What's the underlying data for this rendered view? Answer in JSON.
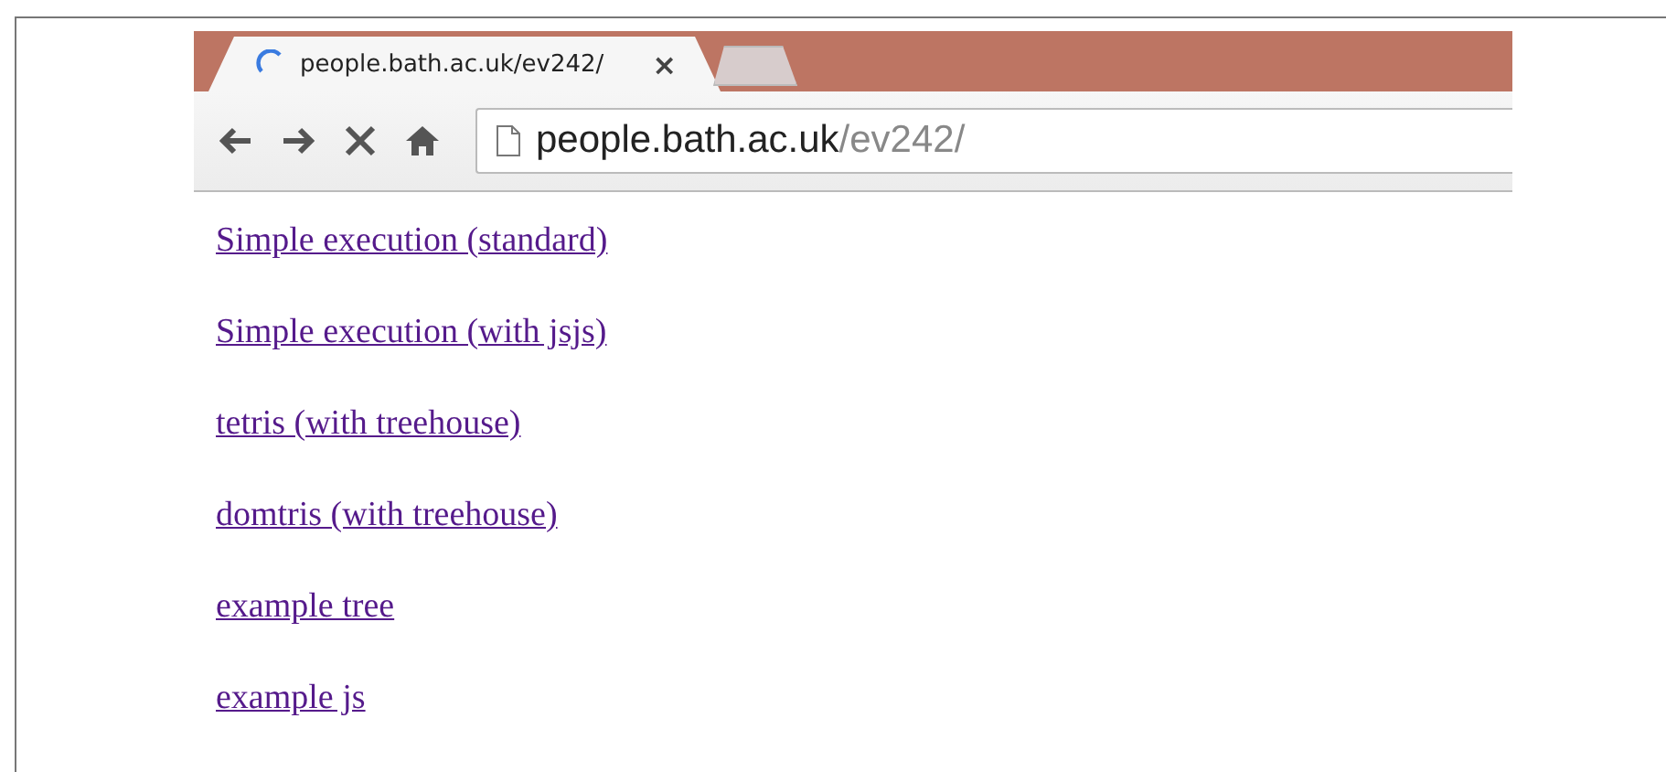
{
  "browser": {
    "tabs": [
      {
        "title": "people.bath.ac.uk/ev242/",
        "close": "×",
        "loading": true,
        "selected": true
      }
    ],
    "address": {
      "host": "people.bath.ac.uk",
      "path": "/ev242/"
    }
  },
  "links": [
    {
      "text": "Simple execution (standard)",
      "visited": true
    },
    {
      "text": "Simple execution (with jsjs)",
      "visited": true
    },
    {
      "text": "tetris (with treehouse)",
      "visited": true
    },
    {
      "text": "domtris (with treehouse)",
      "visited": true
    },
    {
      "text": "example tree",
      "visited": true
    },
    {
      "text": "example js",
      "visited": true
    }
  ]
}
